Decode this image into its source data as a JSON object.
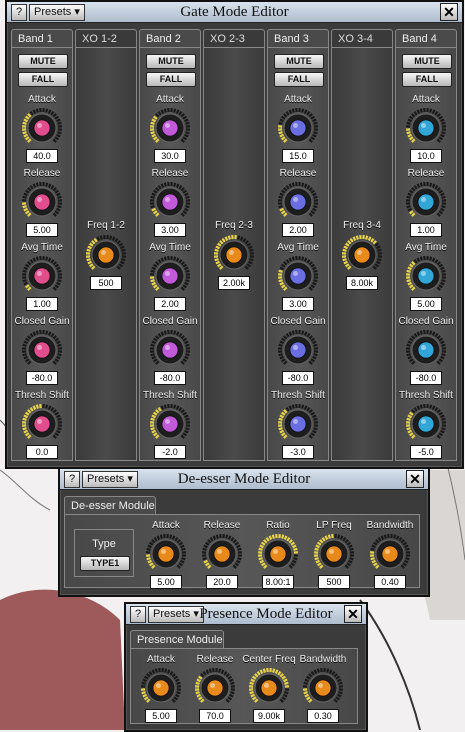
{
  "gate": {
    "title": "Gate Mode Editor",
    "help": "?",
    "presets": "Presets",
    "close": "✕",
    "tabs": [
      "Band 1",
      "XO 1-2",
      "Band 2",
      "XO 2-3",
      "Band 3",
      "XO 3-4",
      "Band 4"
    ],
    "mute": "MUTE",
    "fall": "FALL",
    "param_labels": [
      "Attack",
      "Release",
      "Avg Time",
      "Closed Gain",
      "Thresh Shift"
    ],
    "bands": [
      {
        "color": "#e04e8e",
        "values": [
          "40.0",
          "5.00",
          "1.00",
          "-80.0",
          "0.0"
        ],
        "levels": [
          0.35,
          0.15,
          0.05,
          0.0,
          0.5
        ]
      },
      {
        "color": "#c05ad8",
        "values": [
          "30.0",
          "3.00",
          "2.00",
          "-80.0",
          "-2.0"
        ],
        "levels": [
          0.3,
          0.1,
          0.15,
          0.0,
          0.4
        ]
      },
      {
        "color": "#6a6ee0",
        "values": [
          "15.0",
          "2.00",
          "3.00",
          "-80.0",
          "-3.0"
        ],
        "levels": [
          0.2,
          0.08,
          0.25,
          0.0,
          0.35
        ]
      },
      {
        "color": "#33a6d8",
        "values": [
          "10.0",
          "1.00",
          "5.00",
          "-80.0",
          "-5.0"
        ],
        "levels": [
          0.15,
          0.05,
          0.35,
          0.0,
          0.3
        ]
      }
    ],
    "disabled_value": "2.00",
    "crossovers": [
      {
        "label": "Freq 1-2",
        "value": "500",
        "level": 0.4
      },
      {
        "label": "Freq 2-3",
        "value": "2.00k",
        "level": 0.55
      },
      {
        "label": "Freq 3-4",
        "value": "8.00k",
        "level": 0.7
      }
    ]
  },
  "deesser": {
    "title": "De-esser Mode Editor",
    "help": "?",
    "presets": "Presets",
    "close": "✕",
    "tab": "De-esser Module",
    "type_label": "Type",
    "type_value": "TYPE1",
    "knobs": [
      {
        "label": "Attack",
        "value": "5.00",
        "level": 0.15
      },
      {
        "label": "Release",
        "value": "20.0",
        "level": 0.1
      },
      {
        "label": "Ratio",
        "value": "8.00:1",
        "level": 0.85
      },
      {
        "label": "LP Freq",
        "value": "500",
        "level": 0.5
      },
      {
        "label": "Bandwidth",
        "value": "0.40",
        "level": 0.2
      }
    ]
  },
  "presence": {
    "title": "Presence Mode Editor",
    "help": "?",
    "presets": "Presets",
    "close": "✕",
    "tab": "Presence Module",
    "knobs": [
      {
        "label": "Attack",
        "value": "5.00",
        "level": 0.15
      },
      {
        "label": "Release",
        "value": "70.0",
        "level": 0.3
      },
      {
        "label": "Center Freq",
        "value": "9.00k",
        "level": 0.85
      },
      {
        "label": "Bandwidth",
        "value": "0.30",
        "level": 0.15
      }
    ]
  },
  "colors": {
    "orange": "#e88a1a",
    "yellow": "#e8d24a"
  }
}
